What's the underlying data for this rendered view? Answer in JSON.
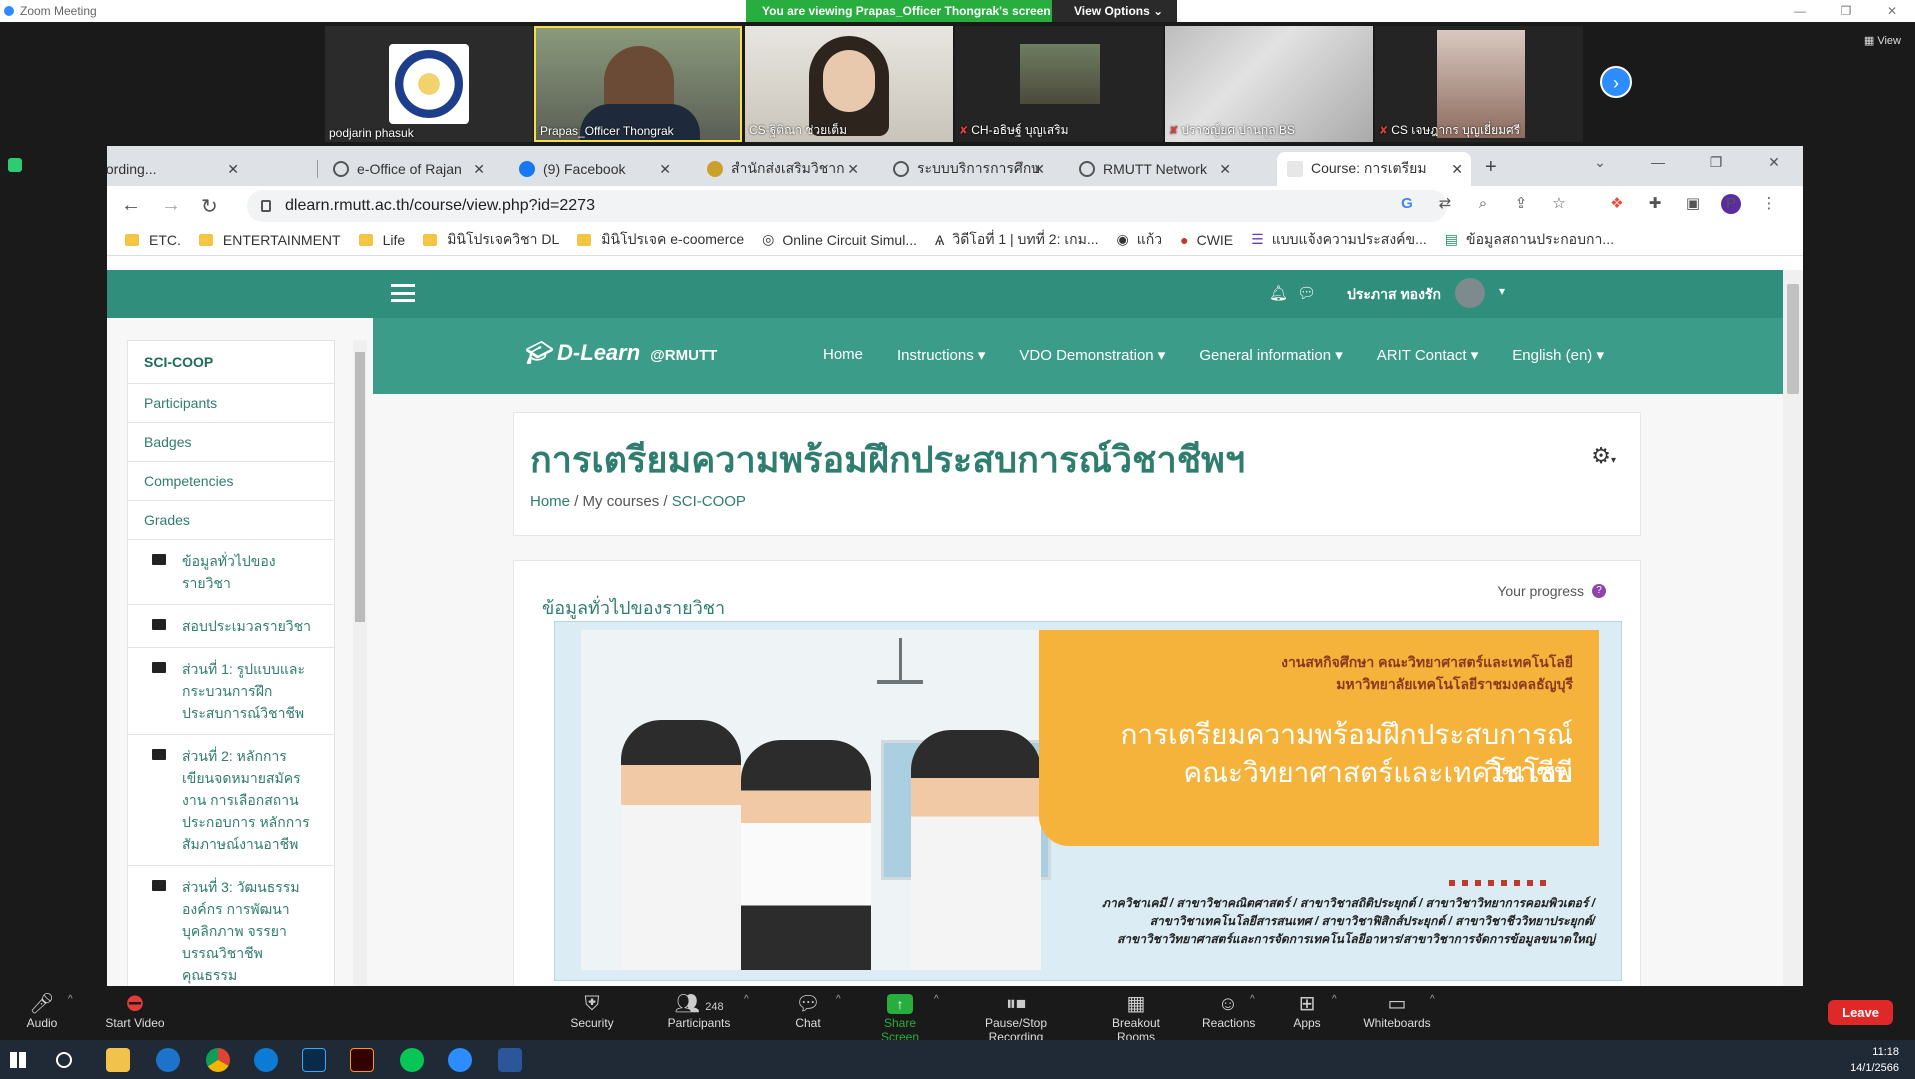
{
  "zoom": {
    "window_title": "Zoom Meeting",
    "viewing_banner": "You are viewing Prapas_Officer Thongrak's screen",
    "view_options": "View Options",
    "view_label": "View",
    "recording_label": "Recording..."
  },
  "participants": [
    {
      "name": "podjarin phasuk",
      "muted": false
    },
    {
      "name": "Prapas_Officer Thongrak",
      "muted": false
    },
    {
      "name": "CS-ฐิติณา ช่วยเต็ม",
      "muted": false
    },
    {
      "name": "CH-อธิษฐ์ บุญเสริม",
      "muted": true
    },
    {
      "name": "ปราชญ์ยศ ปานกุล BS",
      "muted": true
    },
    {
      "name": "CS เจษฎากร บุญเยี่ยมศรี",
      "muted": true
    }
  ],
  "browser": {
    "tabs": [
      {
        "label": "Recording...",
        "active": false
      },
      {
        "label": "e-Office of Rajan",
        "active": false
      },
      {
        "label": "(9) Facebook",
        "active": false
      },
      {
        "label": "สำนักส่งเสริมวิชาก",
        "active": false
      },
      {
        "label": "ระบบบริการการศึกษ",
        "active": false
      },
      {
        "label": "RMUTT Network",
        "active": false
      },
      {
        "label": "Course: การเตรียม",
        "active": true
      }
    ],
    "url": "dlearn.rmutt.ac.th/course/view.php?id=2273",
    "profile_initial": "P",
    "bookmarks": [
      "ETC.",
      "ENTERTAINMENT",
      "Life",
      "มินิโปรเจควิชา DL",
      "มินิโปรเจค e-coomerce",
      "Online Circuit Simul...",
      "วิดีโอที่ 1 | บทที่ 2: เกม...",
      "แก้ว",
      "CWIE",
      "แบบแจ้งความประสงค์ข...",
      "ข้อมูลสถานประกอบกา..."
    ]
  },
  "site": {
    "username": "ประภาส ทองรัก",
    "brand": "D-Learn",
    "brand_sub": "@RMUTT",
    "nav": [
      "Home",
      "Instructions ▾",
      "VDO Demonstration ▾",
      "General information ▾",
      "ARIT Contact ▾",
      "English (en) ▾"
    ]
  },
  "sidebar": {
    "course_short": "SCI-COOP",
    "items": [
      "Participants",
      "Badges",
      "Competencies",
      "Grades"
    ],
    "sections": [
      "ข้อมูลทั่วไปของรายวิชา",
      "สอบประเมวลรายวิชา",
      "ส่วนที่ 1: รูปแบบและกระบวนการฝึกประสบการณ์วิชาชีพ",
      "ส่วนที่ 2: หลักการเขียนจดหมายสมัครงาน การเลือกสถานประกอบการ หลักการสัมภาษณ์งานอาชีพ",
      "ส่วนที่ 3: วัฒนธรรมองค์กร การพัฒนาบุคลิกภาพ จรรยาบรรณวิชาชีพ คุณธรรม"
    ]
  },
  "course": {
    "title": "การเตรียมความพร้อมฝึกประสบการณ์วิชาชีพฯ",
    "breadcrumb": [
      "Home",
      "My courses",
      "SCI-COOP"
    ],
    "section_title": "ข้อมูลทั่วไปของรายวิชา",
    "progress_label": "Your progress"
  },
  "banner": {
    "org_line1": "งานสหกิจศึกษา คณะวิทยาศาสตร์และเทคโนโลยี",
    "org_line2": "มหาวิทยาลัยเทคโนโลยีราชมงคลธัญบุรี",
    "headline1": "การเตรียมความพร้อมฝึกประสบการณ์วิชาชีพ",
    "headline2": "คณะวิทยาศาสตร์และเทคโนโลยี",
    "programs1": "ภาควิชาเคมี / สาขาวิชาคณิตศาสตร์ / สาขาวิชาสถิติประยุกต์ / สาขาวิชาวิทยาการคอมพิวเตอร์ /",
    "programs2": "สาขาวิชาเทคโนโลยีสารสนเทศ / สาขาวิชาฟิสิกส์ประยุกต์ / สาขาวิชาชีววิทยาประยุกต์/",
    "programs3": "สาขาวิชาวิทยาศาสตร์และการจัดการเทคโนโลยีอาหาร/สาขาวิชาการจัดการข้อมูลขนาดใหญ่"
  },
  "controls": {
    "audio": "Audio",
    "start_video": "Start Video",
    "security": "Security",
    "participants": "Participants",
    "participants_count": "248",
    "chat": "Chat",
    "share_screen": "Share Screen",
    "pause_recording": "Pause/Stop Recording",
    "breakout": "Breakout Rooms",
    "reactions": "Reactions",
    "apps": "Apps",
    "whiteboards": "Whiteboards",
    "leave": "Leave"
  },
  "taskbar": {
    "time": "11:18",
    "date": "14/1/2566"
  }
}
